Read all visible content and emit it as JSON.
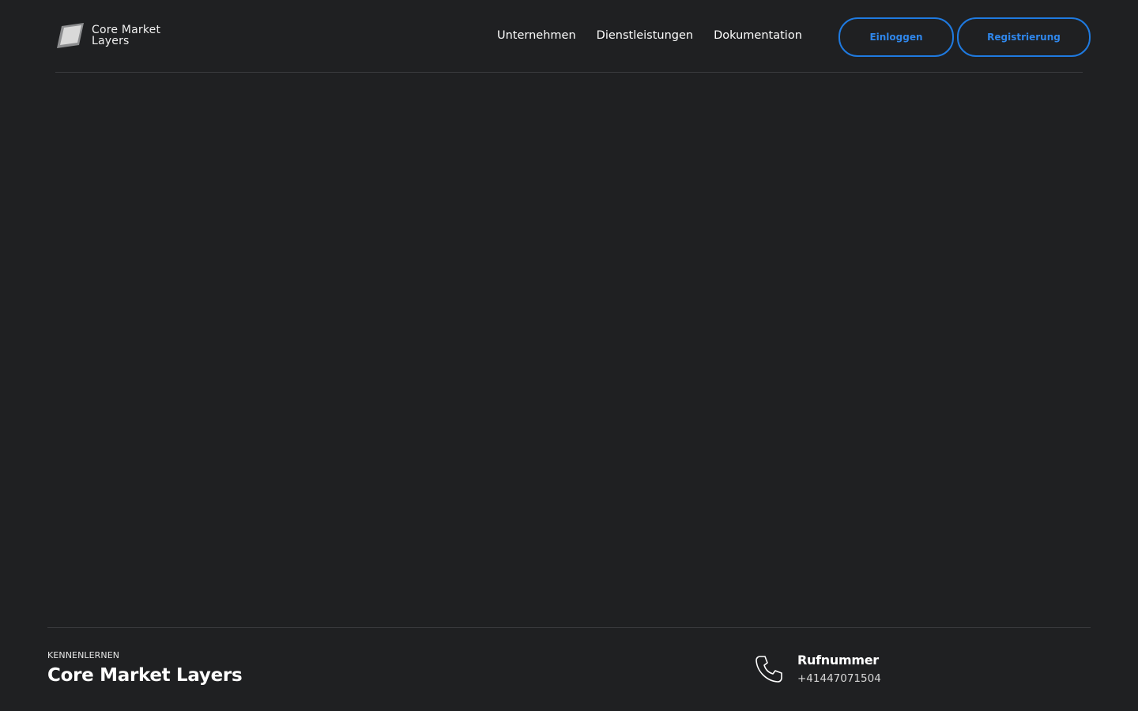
{
  "header": {
    "logo": {
      "line1": "Core Market",
      "line2": "Layers"
    },
    "nav": [
      {
        "label": "Unternehmen"
      },
      {
        "label": "Dienstleistungen"
      },
      {
        "label": "Dokumentation"
      }
    ],
    "login_label": "Einloggen",
    "register_label": "Registrierung"
  },
  "footer": {
    "kicker": "KENNENLERNEN",
    "title": "Core Market Layers",
    "contact": {
      "label": "Rufnummer",
      "value": "+41447071504",
      "icon": "phone-icon"
    }
  },
  "colors": {
    "background": "#1f2022",
    "accent": "#1f7ae0",
    "divider": "#3a3b3e"
  }
}
